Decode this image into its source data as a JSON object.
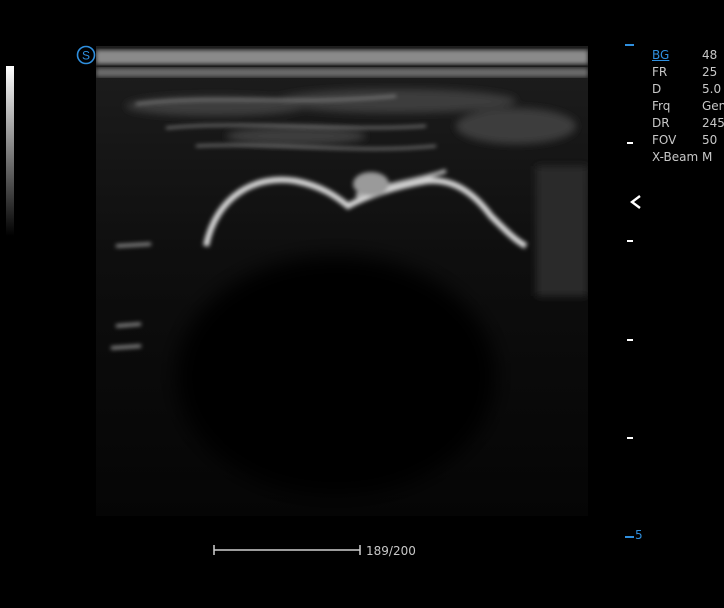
{
  "parameters": [
    {
      "label": "BG",
      "value": "48",
      "active": true
    },
    {
      "label": "FR",
      "value": "25"
    },
    {
      "label": "D",
      "value": "5.0"
    },
    {
      "label": "Frq",
      "value": "Gen"
    },
    {
      "label": "DR",
      "value": "245"
    },
    {
      "label": "FOV",
      "value": "50"
    },
    {
      "label": "X-Beam",
      "value": "M"
    }
  ],
  "depth_scale": {
    "max_label": "5"
  },
  "scale_bar": {
    "label": "189/200"
  },
  "icons": {
    "probe_marker": "probe-orientation-icon",
    "focus": "focus-marker-icon"
  },
  "colors": {
    "accent": "#2f8fde",
    "background": "#000000"
  }
}
